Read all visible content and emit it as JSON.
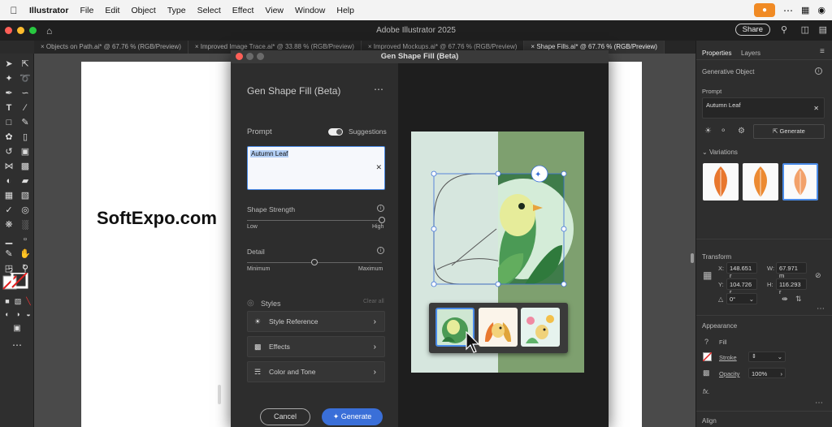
{
  "menubar": {
    "app_name": "Illustrator",
    "items": [
      "File",
      "Edit",
      "Object",
      "Type",
      "Select",
      "Effect",
      "View",
      "Window",
      "Help"
    ],
    "icons": [
      "apple-icon",
      "mic-icon",
      "more-icon",
      "control-center-icon",
      "siri-icon"
    ]
  },
  "app": {
    "title": "Adobe Illustrator 2025",
    "share_label": "Share"
  },
  "tabs": [
    {
      "label": "Objects on Path.ai* @ 67.76 % (RGB/Preview)"
    },
    {
      "label": "Improved Image Trace.ai* @ 33.88 % (RGB/Preview)"
    },
    {
      "label": "Improved Mockups.ai* @ 67.76 % (RGB/Preview)"
    },
    {
      "label": "Shape Fills.ai* @ 67.76 % (RGB/Preview)"
    }
  ],
  "watermark": "SoftExpo.com",
  "dialog": {
    "window_title": "Gen Shape Fill (Beta)",
    "heading": "Gen Shape Fill (Beta)",
    "prompt_label": "Prompt",
    "suggestions_label": "Suggestions",
    "suggestions_on": true,
    "prompt_value": "Autumn Leaf",
    "shape_strength_label": "Shape Strength",
    "shape_strength_min": "Low",
    "shape_strength_max": "High",
    "shape_strength_value": 1.0,
    "detail_label": "Detail",
    "detail_min": "Minimum",
    "detail_max": "Maximum",
    "detail_value": 0.5,
    "styles_label": "Styles",
    "clear_all_label": "Clear all",
    "accordions": [
      {
        "label": "Style Reference",
        "icon": "style-reference-icon"
      },
      {
        "label": "Effects",
        "icon": "effects-icon"
      },
      {
        "label": "Color and Tone",
        "icon": "color-tone-icon"
      }
    ],
    "cancel_label": "Cancel",
    "generate_label": "Generate"
  },
  "panel": {
    "tab_properties": "Properties",
    "tab_layers": "Layers",
    "section_title": "Generative Object",
    "prompt_label": "Prompt",
    "prompt_value": "Autumn Leaf",
    "generate_label": "Generate",
    "variations_label": "Variations",
    "transform_label": "Transform",
    "x_label": "X:",
    "x_value": "148.651 r",
    "w_label": "W:",
    "w_value": "67.971 m",
    "y_label": "Y:",
    "y_value": "104.726 r",
    "h_label": "H:",
    "h_value": "116.293 r",
    "rotate_value": "0°",
    "appearance_label": "Appearance",
    "fill_label": "Fill",
    "stroke_label": "Stroke",
    "opacity_label": "Opacity",
    "opacity_value": "100%",
    "fx_label": "fx.",
    "align_label": "Align"
  },
  "colors": {
    "accent_blue": "#3a6fd8",
    "mic_orange": "#f08a24",
    "preview_mint": "#d6e6de",
    "preview_green": "#7ea06f",
    "leaf_orange": "#e8772e"
  }
}
